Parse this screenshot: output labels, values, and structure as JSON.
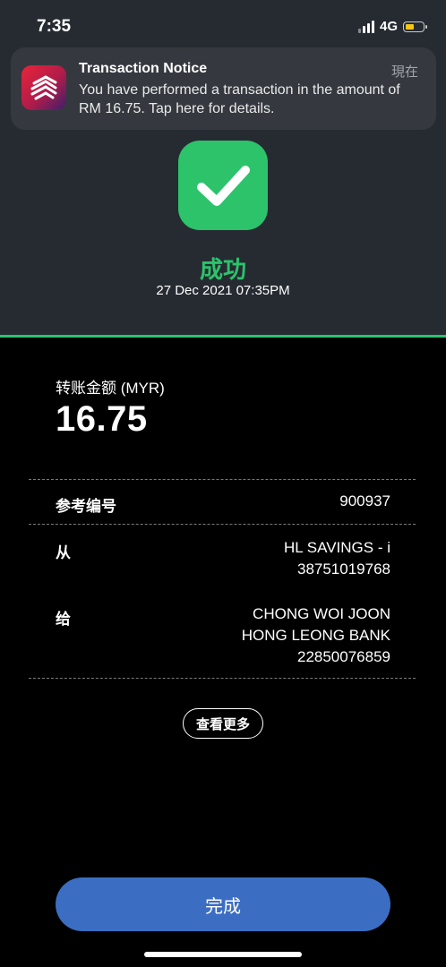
{
  "status_bar": {
    "time": "7:35",
    "network": "4G",
    "battery_color": "#f5c518"
  },
  "notification": {
    "title": "Transaction Notice",
    "time": "現在",
    "body": "You have performed a transaction in the amount of RM 16.75. Tap here for details.",
    "app_icon": "bank-app-icon"
  },
  "result": {
    "icon": "check-icon",
    "status": "成功",
    "datetime": "27 Dec 2021 07:35PM",
    "accent_color": "#2cc36b"
  },
  "transfer": {
    "amount_label": "转账金额 (MYR)",
    "amount": "16.75",
    "reference_label": "参考编号",
    "reference_value": "900937",
    "from_label": "从",
    "from_line1": "HL SAVINGS - i",
    "from_line2": "38751019768",
    "to_label": "给",
    "to_line1": "CHONG WOI JOON",
    "to_line2": "HONG LEONG BANK",
    "to_line3": "22850076859"
  },
  "actions": {
    "more_label": "查看更多",
    "done_label": "完成",
    "done_color": "#3b6ec2"
  }
}
